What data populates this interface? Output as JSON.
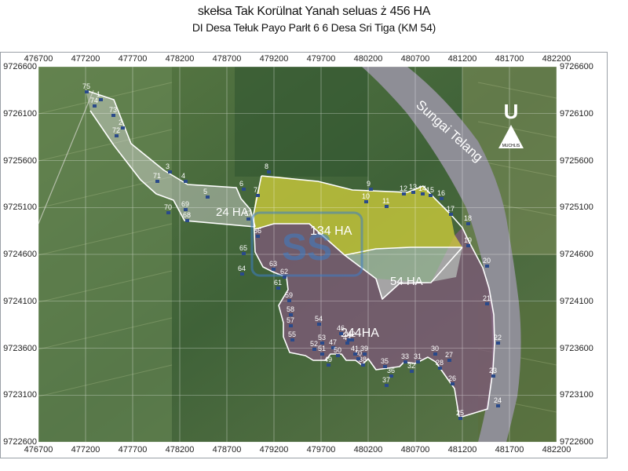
{
  "title": "skełsa Tak Korülnat Yanah seluas ż 456 HA",
  "subtitle": "DI Desa Tełuk Payo Parłt 6 6 Desa Sri Tiga (KM 54)",
  "axes": {
    "x_ticks": [
      "476700",
      "477200",
      "477700",
      "478200",
      "478700",
      "479200",
      "479700",
      "480200",
      "480700",
      "481200",
      "481700",
      "482200"
    ],
    "y_ticks": [
      "9726600",
      "9726100",
      "9725600",
      "9725100",
      "9724600",
      "9724100",
      "9723600",
      "9723100",
      "9722600"
    ]
  },
  "areas": [
    {
      "label": "134 HA",
      "color": "#d8d43a"
    },
    {
      "label": "24 HA",
      "color": "#ffffff"
    },
    {
      "label": "54 HA",
      "color": "#c8d8d0"
    },
    {
      "label": "244HA",
      "color": "#8a6a8a"
    }
  ],
  "river_label": "Sungai Telang",
  "north_arrow": {
    "letter": "U",
    "caption": "MUCHLIS"
  },
  "watermark": "SS",
  "colors": {
    "boundary": "#ffffff",
    "area_134": "#d8d43a",
    "area_244": "#7d5a78",
    "area_54": "#cfe0d6"
  },
  "markers": [
    "1",
    "2",
    "3",
    "4",
    "5",
    "6",
    "7",
    "8",
    "9",
    "10",
    "11",
    "12",
    "13",
    "14",
    "15",
    "16",
    "17",
    "18",
    "19",
    "20",
    "21",
    "22",
    "23",
    "24",
    "25",
    "26",
    "27",
    "28",
    "30",
    "31",
    "32",
    "33",
    "35",
    "36",
    "37",
    "38",
    "39",
    "40",
    "41",
    "42",
    "43",
    "45",
    "46",
    "47",
    "49",
    "50",
    "51",
    "52",
    "53",
    "54",
    "55",
    "57",
    "58",
    "59",
    "61",
    "62",
    "63",
    "64",
    "65",
    "66",
    "67",
    "68",
    "69",
    "70",
    "71",
    "72",
    "73",
    "74",
    "75"
  ]
}
